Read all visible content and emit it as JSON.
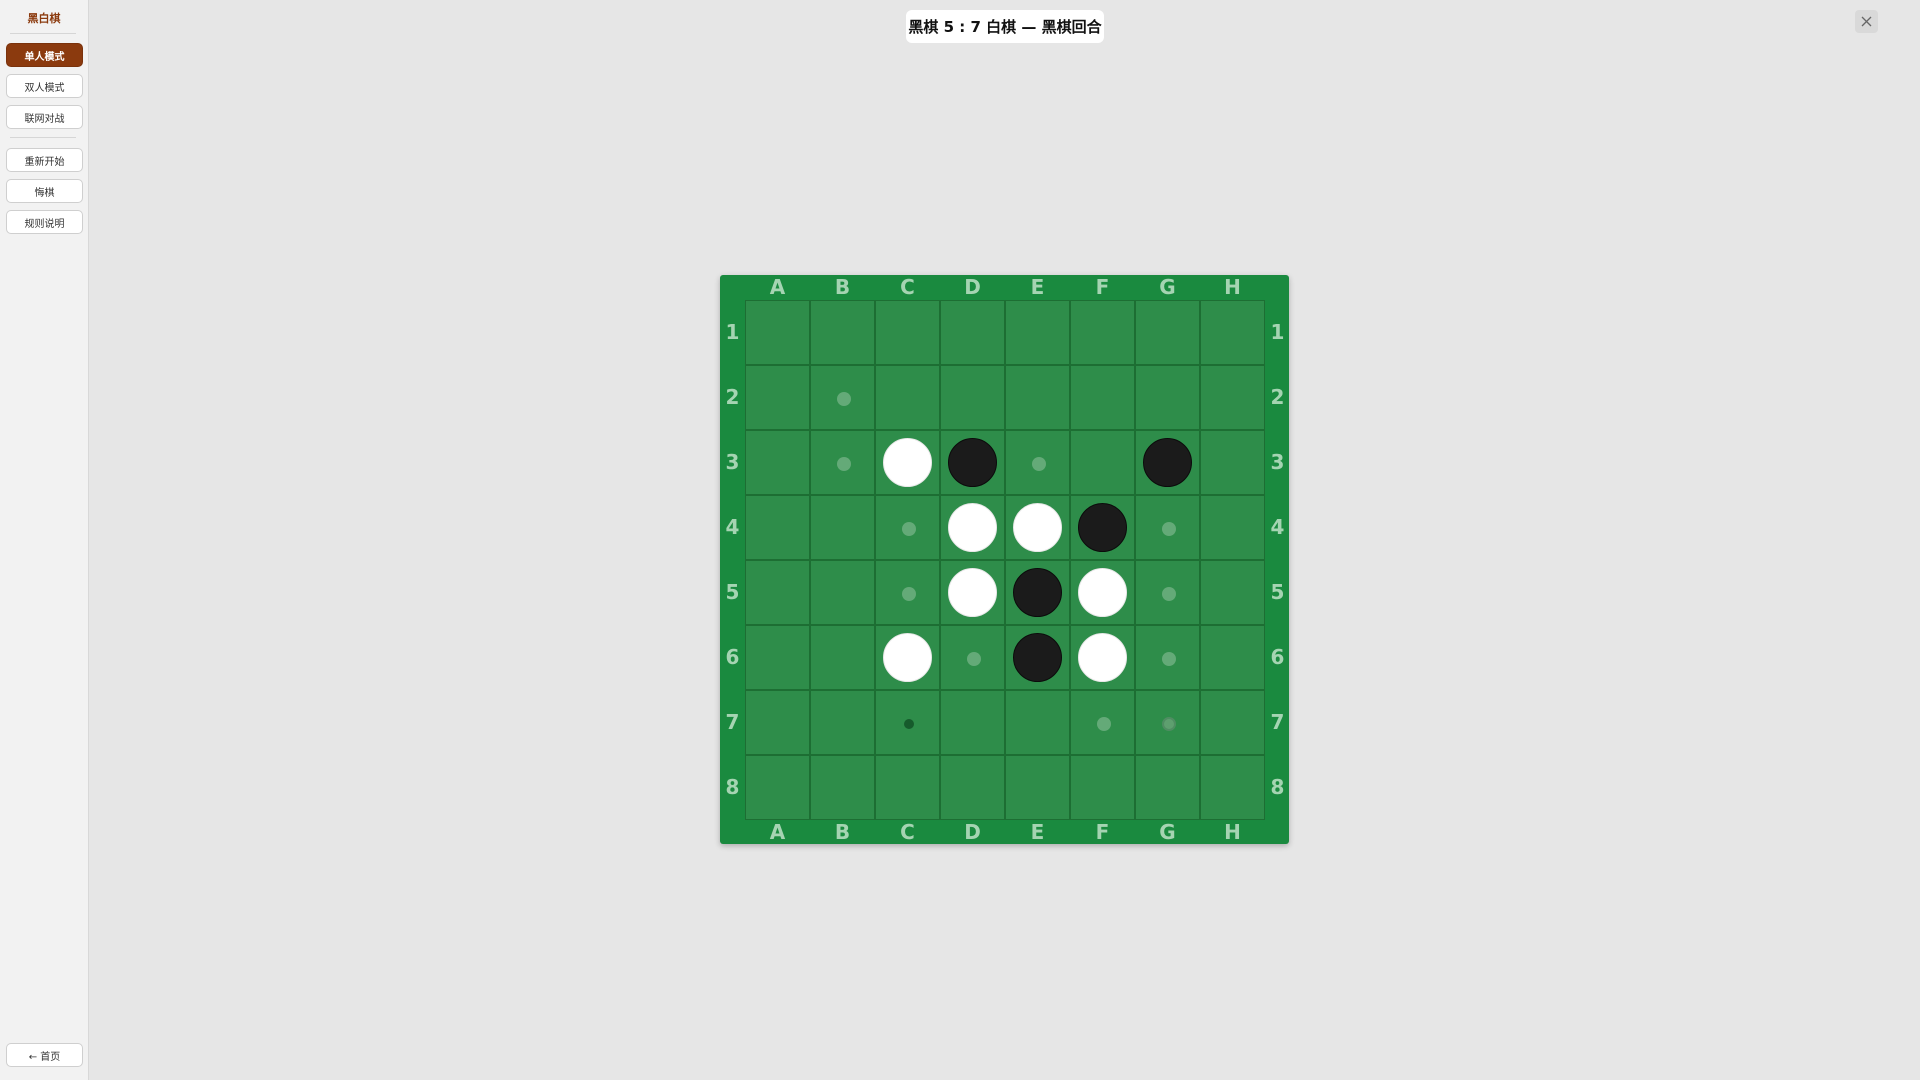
{
  "sidebar": {
    "title": "黑白棋",
    "mode_buttons": [
      "单人模式",
      "双人模式",
      "联网对战"
    ],
    "action_buttons": [
      "重新开始",
      "悔棋",
      "规则说明"
    ],
    "home_button": "← 首页",
    "active_index": 0
  },
  "status": {
    "text": "黑棋 5 : 7 白棋 — 黑棋回合"
  },
  "window": {
    "close_icon": "close-icon"
  },
  "board": {
    "columns": [
      "A",
      "B",
      "C",
      "D",
      "E",
      "F",
      "G",
      "H"
    ],
    "rows": [
      "1",
      "2",
      "3",
      "4",
      "5",
      "6",
      "7",
      "8"
    ],
    "cells": [
      [
        ".",
        ".",
        ".",
        ".",
        ".",
        ".",
        ".",
        "."
      ],
      [
        ".",
        "h",
        ".",
        ".",
        ".",
        ".",
        ".",
        "."
      ],
      [
        ".",
        "h",
        "W",
        "B",
        "h",
        ".",
        "B",
        "."
      ],
      [
        ".",
        ".",
        "h",
        "W",
        "W",
        "B",
        "h",
        "."
      ],
      [
        ".",
        ".",
        "h",
        "W",
        "B",
        "W",
        "h",
        "."
      ],
      [
        ".",
        ".",
        "W",
        "h",
        "B",
        "W",
        "h",
        "."
      ],
      [
        ".",
        ".",
        "s",
        ".",
        ".",
        "h",
        "r",
        "."
      ],
      [
        ".",
        ".",
        ".",
        ".",
        ".",
        ".",
        ".",
        "."
      ]
    ],
    "legend": {
      "W": "white piece",
      "B": "black piece",
      "h": "valid move hint",
      "s": "last-move marker",
      "r": "hovered hint"
    }
  },
  "colors": {
    "accent": "#8b3a0e",
    "board_border": "#1a8a3f",
    "board_cell": "#2e8d4a",
    "coord_text": "#a5d4b2"
  }
}
